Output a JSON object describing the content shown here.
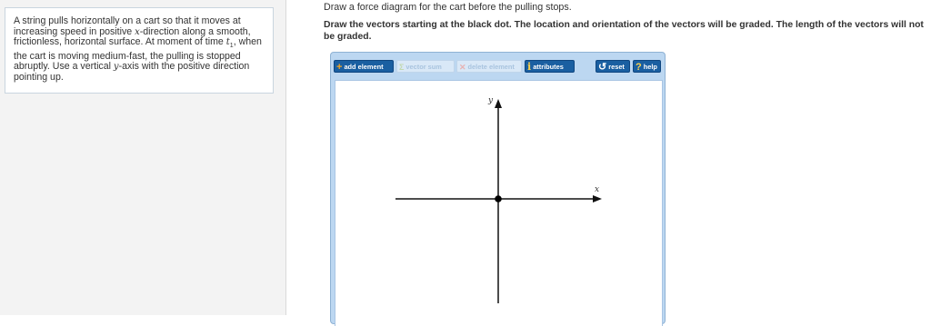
{
  "problem": {
    "text_pre_x": "A string pulls horizontally on a cart so that it moves at increasing speed in positive ",
    "var_x": "x",
    "text_mid": "-direction along a smooth, frictionless, horizontal surface. At moment of time ",
    "var_t": "t",
    "var_t_sub": "1",
    "text_after_t": ", when the cart is moving medium-fast, the pulling is stopped abruptly. Use a vertical ",
    "var_y": "y",
    "text_end": "-axis with the positive direction pointing up."
  },
  "instructions": {
    "line1": "Draw a force diagram for the cart before the pulling stops.",
    "line2": "Draw the vectors starting at the black dot. The location and orientation of the vectors will be graded. The length of the vectors will not be graded."
  },
  "toolbar": {
    "add_element": "add element",
    "vector_sum": "vector sum",
    "delete_element": "delete element",
    "attributes": "attributes",
    "reset": "reset",
    "help": "help",
    "add_glyph": "+",
    "vector_sum_glyph": "Σ",
    "delete_glyph": "✕",
    "attributes_glyph": "i",
    "reset_glyph": "↺",
    "help_glyph": "?",
    "accent_color": "#1a5fa1",
    "plus_color": "#f5a623"
  },
  "graph": {
    "x_label": "x",
    "y_label": "y"
  }
}
